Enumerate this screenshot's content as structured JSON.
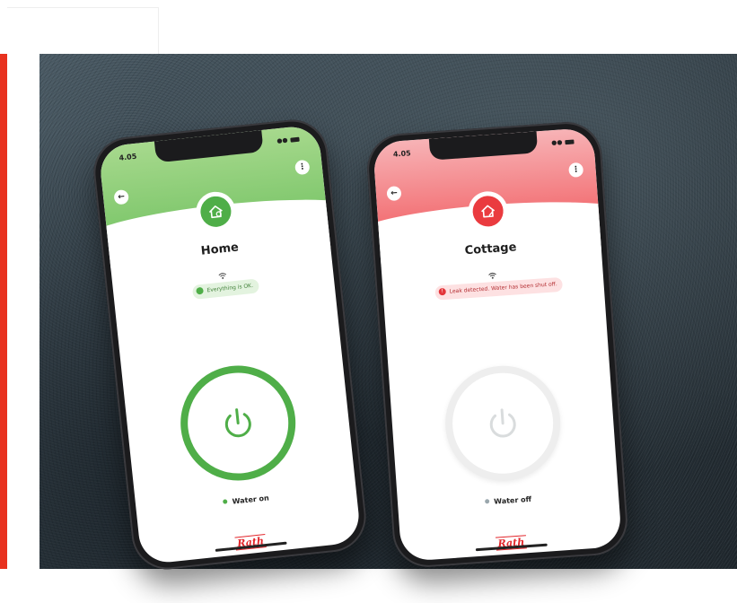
{
  "phones": [
    {
      "time": "4.05",
      "location": "Home",
      "status_message": "Everything is OK.",
      "water_status": "Water on",
      "brand": "Rath",
      "theme": "green",
      "accent_color": "#4fae48",
      "icons": [
        "back-arrow-icon",
        "more-options-icon",
        "home-icon",
        "wifi-icon",
        "power-icon"
      ]
    },
    {
      "time": "4.05",
      "location": "Cottage",
      "status_message": "Leak detected. Water has been shut off.",
      "water_status": "Water off",
      "brand": "Rath",
      "theme": "red",
      "accent_color": "#ea3b3f",
      "icons": [
        "back-arrow-icon",
        "more-options-icon",
        "home-leak-icon",
        "wifi-icon",
        "power-icon"
      ]
    }
  ],
  "colors": {
    "brand_red": "#e2262b",
    "ok_green": "#4fae48",
    "alert_red": "#ea3b3f"
  }
}
